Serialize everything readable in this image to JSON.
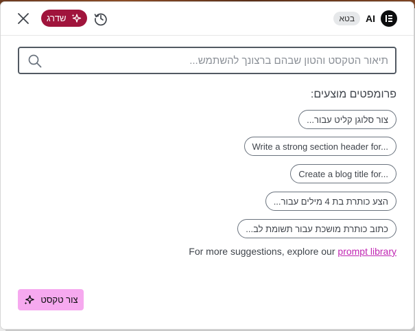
{
  "header": {
    "brand_label": "AI",
    "beta_badge": "בטא",
    "upgrade_label": "שדרג"
  },
  "search": {
    "placeholder": "תיאור הטקסט והטון שבהם ברצונך להשתמש...",
    "value": ""
  },
  "suggestions": {
    "title": "פרומפטים מוצעים:",
    "items": [
      "צור סלוגן קליט עבור...",
      "Write a strong section header for...",
      "Create a blog title for...",
      "הצע כותרת בת 4 מילים עבור...",
      "כתוב כותרת מושכת עבור תשומת לב..."
    ],
    "more_text": "For more suggestions, explore our ",
    "more_link": "prompt library"
  },
  "footer": {
    "generate_label": "צור טקסט"
  },
  "colors": {
    "upgrade_bg": "#a0143c",
    "link": "#c026b2",
    "generate_bg": "#f6a9ef"
  },
  "icons": [
    "close-icon",
    "sparkle-icon",
    "history-icon",
    "elementor-logo-icon",
    "search-icon"
  ]
}
